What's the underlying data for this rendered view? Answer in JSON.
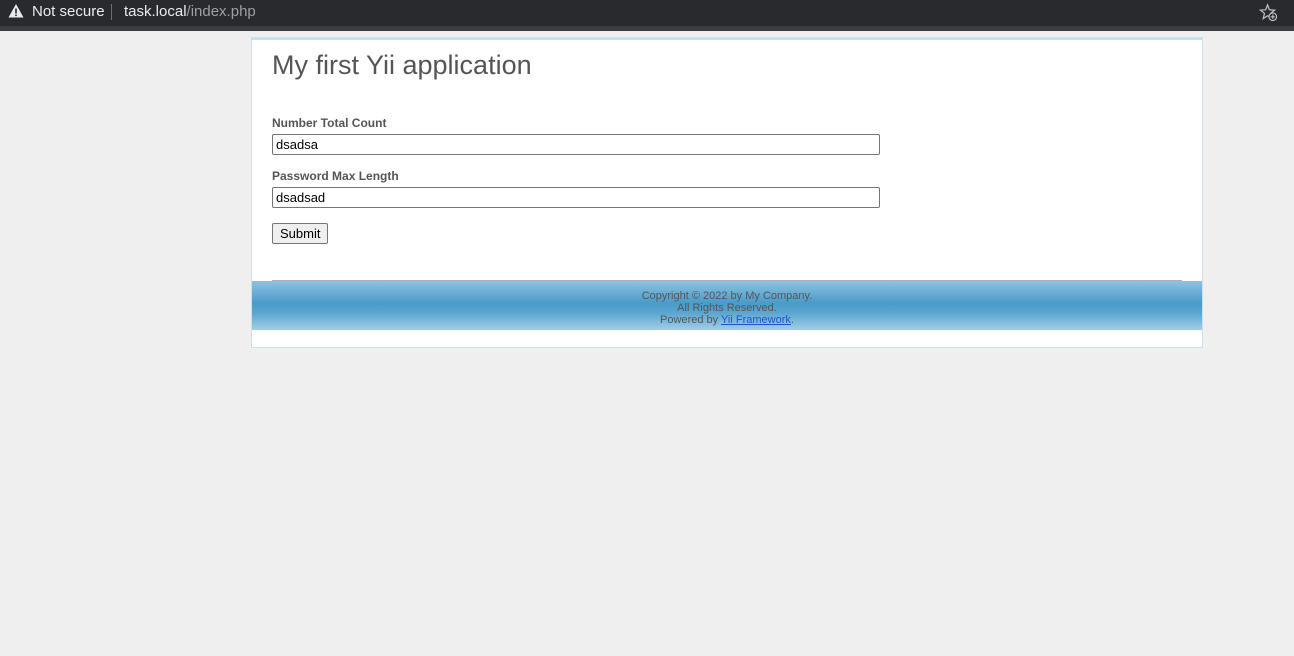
{
  "browser": {
    "security_label": "Not secure",
    "url_host": "task.local",
    "url_path": "/index.php",
    "icons": [
      "warning-icon",
      "favorite-star-add-icon"
    ]
  },
  "header": {
    "title": "My first Yii application"
  },
  "form": {
    "fields": [
      {
        "label": "Number Total Count",
        "value": "dsadsa"
      },
      {
        "label": "Password Max Length",
        "value": "dsadsad"
      }
    ],
    "submit_label": "Submit"
  },
  "footer": {
    "copyright": "Copyright © 2022 by My Company.",
    "rights": "All Rights Reserved.",
    "powered_prefix": "Powered by ",
    "powered_link": "Yii Framework",
    "powered_suffix": "."
  },
  "colors": {
    "page_bg": "#efefef",
    "text": "#555555",
    "link": "#1a55cc",
    "footer_blue": "#4a9bc9"
  }
}
